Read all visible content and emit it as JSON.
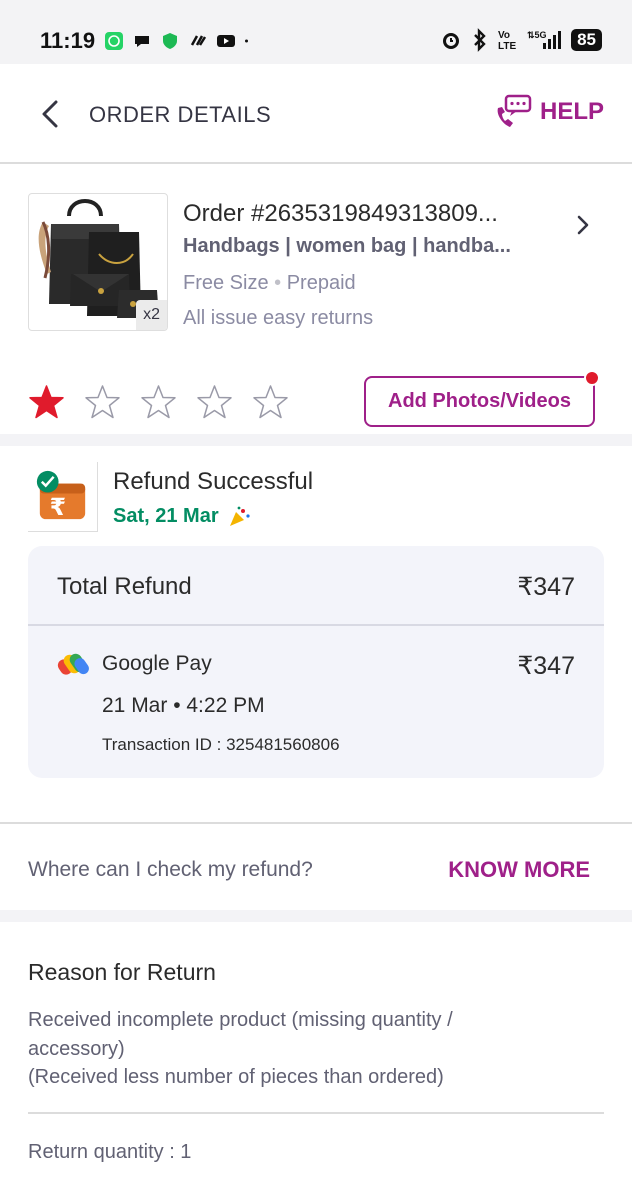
{
  "status_bar": {
    "time": "11:19",
    "battery": "85",
    "network": "5G",
    "apps": [
      "whatsapp-icon",
      "chat-icon",
      "shield-icon",
      "link-icon",
      "youtube-icon"
    ]
  },
  "header": {
    "title": "ORDER DETAILS",
    "help_label": "HELP"
  },
  "order": {
    "id_label": "Order #2635319849313809...",
    "product_name": "Handbags | women bag | handba...",
    "size": "Free Size",
    "payment": "Prepaid",
    "returns_note": "All issue easy returns",
    "quantity_badge": "x2",
    "rating": 1,
    "rating_max": 5,
    "add_media_label": "Add Photos/Videos"
  },
  "refund": {
    "status": "Refund Successful",
    "date": "Sat, 21 Mar",
    "total_label": "Total Refund",
    "total_value": "₹347",
    "method_name": "Google Pay",
    "method_amount": "₹347",
    "datetime": "21 Mar • 4:22 PM",
    "transaction": "Transaction ID : 325481560806"
  },
  "refund_help": {
    "question": "Where can I check my refund?",
    "link_label": "KNOW MORE"
  },
  "return_reason": {
    "title": "Reason for Return",
    "reason": "Received incomplete product (missing quantity / accessory)",
    "detail": "(Received less number of pieces than ordered)",
    "quantity_text": "Return quantity  : 1"
  },
  "colors": {
    "brand": "#9f2089",
    "success": "#038d63",
    "star_filled": "#e01b2c"
  }
}
